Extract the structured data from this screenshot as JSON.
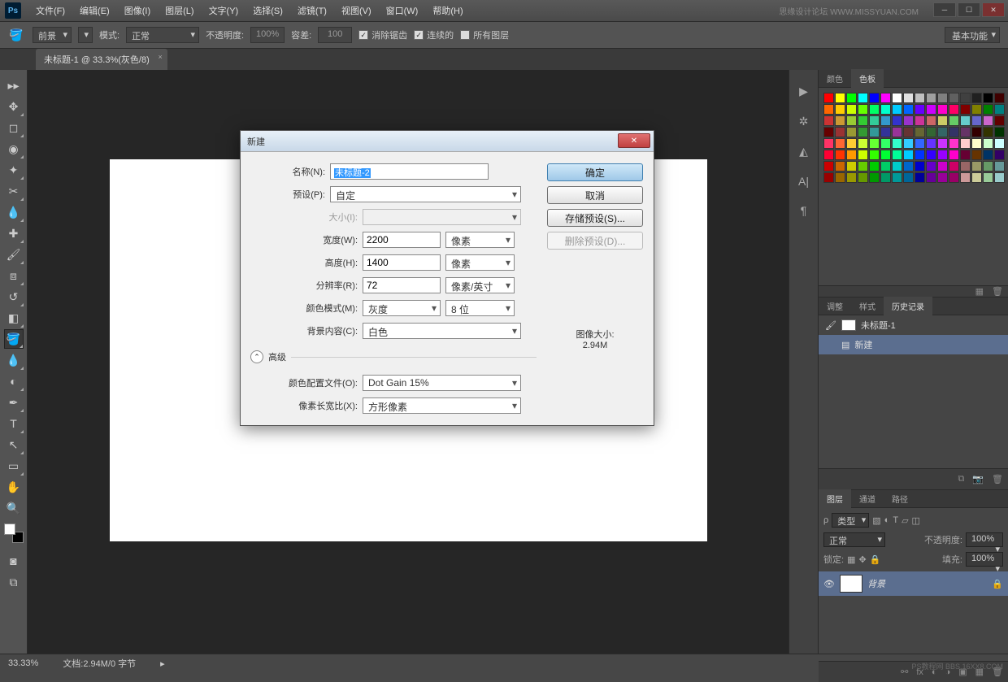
{
  "titlebar": {
    "logo": "Ps",
    "brand": "思缘设计论坛 WWW.MISSYUAN.COM"
  },
  "menu": [
    "文件(F)",
    "编辑(E)",
    "图像(I)",
    "图层(L)",
    "文字(Y)",
    "选择(S)",
    "滤镜(T)",
    "视图(V)",
    "窗口(W)",
    "帮助(H)"
  ],
  "options": {
    "fill_label": "前景",
    "mode_label": "模式:",
    "mode_value": "正常",
    "opacity_label": "不透明度:",
    "opacity_value": "100%",
    "tolerance_label": "容差:",
    "tolerance_value": "100",
    "antialias": "消除锯齿",
    "contiguous": "连续的",
    "all_layers": "所有图层",
    "essentials": "基本功能"
  },
  "doc_tab": "未标题-1 @ 33.3%(灰色/8)",
  "panels": {
    "color_tab": "颜色",
    "swatch_tab": "色板",
    "adjust_tab": "调整",
    "style_tab": "样式",
    "history_tab": "历史记录",
    "hist_doc": "未标题-1",
    "hist_step": "新建",
    "layers_tab": "图层",
    "channels_tab": "通道",
    "paths_tab": "路径",
    "kind_label": "类型",
    "blend_value": "正常",
    "opacity_label": "不透明度:",
    "opacity_value": "100%",
    "lock_label": "锁定:",
    "fill_label": "填充:",
    "fill_value": "100%",
    "bg_layer": "背景"
  },
  "status": {
    "zoom": "33.33%",
    "doc_info": "文档:2.94M/0 字节"
  },
  "dialog": {
    "title": "新建",
    "name_label": "名称(N):",
    "name_value": "未标题-2",
    "preset_label": "预设(P):",
    "preset_value": "自定",
    "size_label": "大小(I):",
    "width_label": "宽度(W):",
    "width_value": "2200",
    "width_unit": "像素",
    "height_label": "高度(H):",
    "height_value": "1400",
    "height_unit": "像素",
    "res_label": "分辨率(R):",
    "res_value": "72",
    "res_unit": "像素/英寸",
    "colormode_label": "颜色模式(M):",
    "colormode_value": "灰度",
    "bit_value": "8 位",
    "bg_label": "背景内容(C):",
    "bg_value": "白色",
    "advanced": "高级",
    "profile_label": "颜色配置文件(O):",
    "profile_value": "Dot Gain 15%",
    "aspect_label": "像素长宽比(X):",
    "aspect_value": "方形像素",
    "ok": "确定",
    "cancel": "取消",
    "save_preset": "存储预设(S)...",
    "delete_preset": "删除预设(D)...",
    "img_size_label": "图像大小:",
    "img_size_value": "2.94M"
  },
  "swatch_colors": [
    "#ff0000",
    "#ffff00",
    "#00ff00",
    "#00ffff",
    "#0000ff",
    "#ff00ff",
    "#ffffff",
    "#e0e0e0",
    "#c0c0c0",
    "#a0a0a0",
    "#808080",
    "#606060",
    "#404040",
    "#202020",
    "#000000",
    "#400000",
    "#ff6600",
    "#ffcc00",
    "#ccff00",
    "#66ff00",
    "#00ff66",
    "#00ffcc",
    "#00ccff",
    "#0066ff",
    "#6600ff",
    "#cc00ff",
    "#ff00cc",
    "#ff0066",
    "#800000",
    "#808000",
    "#008000",
    "#008080",
    "#cc3333",
    "#cc9933",
    "#99cc33",
    "#33cc33",
    "#33cc99",
    "#3399cc",
    "#3333cc",
    "#9933cc",
    "#cc3399",
    "#cc6666",
    "#cccc66",
    "#66cc66",
    "#66cccc",
    "#6666cc",
    "#cc66cc",
    "#600000",
    "#660000",
    "#993333",
    "#999933",
    "#339933",
    "#339999",
    "#333399",
    "#993399",
    "#663333",
    "#666633",
    "#336633",
    "#336666",
    "#333366",
    "#663366",
    "#330000",
    "#333300",
    "#003300",
    "#ff3366",
    "#ff6633",
    "#ffcc33",
    "#ccff33",
    "#66ff33",
    "#33ff66",
    "#33ffcc",
    "#33ccff",
    "#3366ff",
    "#6633ff",
    "#cc33ff",
    "#ff33cc",
    "#ffcccc",
    "#ffffcc",
    "#ccffcc",
    "#ccffff",
    "#ff0033",
    "#ff3300",
    "#ff9900",
    "#ccff00",
    "#33ff00",
    "#00ff33",
    "#00ff99",
    "#00ccff",
    "#0033ff",
    "#3300ff",
    "#9900ff",
    "#ff00cc",
    "#660033",
    "#663300",
    "#003366",
    "#330066",
    "#cc0000",
    "#cc6600",
    "#cccc00",
    "#66cc00",
    "#00cc00",
    "#00cc66",
    "#00cccc",
    "#0066cc",
    "#0000cc",
    "#6600cc",
    "#cc00cc",
    "#cc0066",
    "#996666",
    "#999966",
    "#669966",
    "#669999",
    "#990000",
    "#996600",
    "#999900",
    "#669900",
    "#009900",
    "#009966",
    "#009999",
    "#006699",
    "#000099",
    "#660099",
    "#990099",
    "#990066",
    "#cc9999",
    "#cccc99",
    "#99cc99",
    "#99cccc"
  ],
  "watermark": "PS教程网\nBBS.16XX8.COM"
}
